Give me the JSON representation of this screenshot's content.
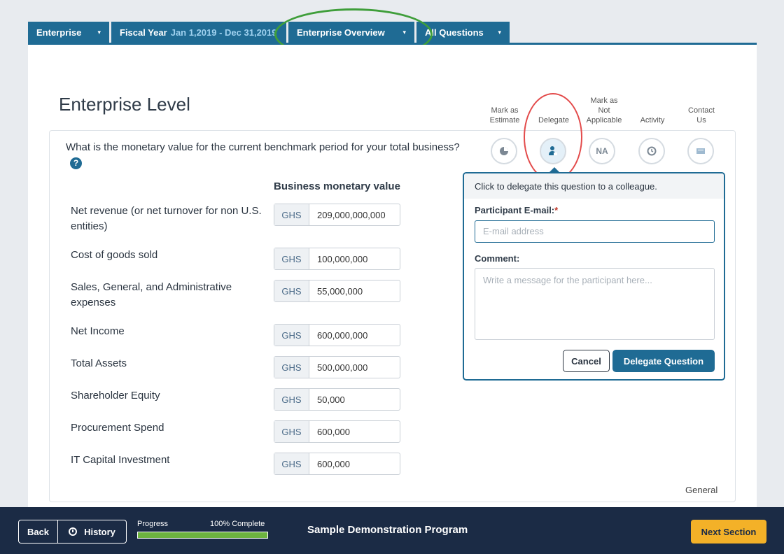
{
  "tabs": {
    "enterprise": "Enterprise",
    "fiscal_year_label": "Fiscal Year",
    "fiscal_year_dates": "Jan 1,2019 - Dec 31,2019",
    "overview": "Enterprise Overview",
    "all_questions": "All Questions",
    "caret": "▾"
  },
  "page_title": "Enterprise Level",
  "question": {
    "text": "What is the monetary value for the current benchmark period for your total business?",
    "help": "?",
    "column_header": "Business monetary value"
  },
  "rows": [
    {
      "label": "Net revenue (or net turnover for non U.S. entities)",
      "currency": "GHS",
      "value": "209,000,000,000"
    },
    {
      "label": "Cost of goods sold",
      "currency": "GHS",
      "value": "100,000,000"
    },
    {
      "label": "Sales, General, and Administrative expenses",
      "currency": "GHS",
      "value": "55,000,000"
    },
    {
      "label": "Net Income",
      "currency": "GHS",
      "value": "600,000,000"
    },
    {
      "label": "Total Assets",
      "currency": "GHS",
      "value": "500,000,000"
    },
    {
      "label": "Shareholder Equity",
      "currency": "GHS",
      "value": "50,000"
    },
    {
      "label": "Procurement Spend",
      "currency": "GHS",
      "value": "600,000"
    },
    {
      "label": "IT Capital Investment",
      "currency": "GHS",
      "value": "600,000"
    }
  ],
  "actions": {
    "estimate_line1": "Mark as",
    "estimate_line2": "Estimate",
    "delegate": "Delegate",
    "na_line1": "Mark as",
    "na_line2": "Not",
    "na_line3": "Applicable",
    "na_icon_text": "NA",
    "activity": "Activity",
    "contact_line1": "Contact",
    "contact_line2": "Us"
  },
  "delegate_popover": {
    "header": "Click to delegate this question to a colleague.",
    "email_label": "Participant E-mail:",
    "required_mark": "*",
    "email_placeholder": "E-mail address",
    "comment_label": "Comment:",
    "comment_placeholder": "Write a message for the participant here...",
    "cancel": "Cancel",
    "submit": "Delegate Question"
  },
  "section_footer": "General",
  "footer": {
    "back": "Back",
    "history": "History",
    "progress_label": "Progress",
    "progress_text": "100% Complete",
    "progress_fraction": 1.0,
    "program": "Sample Demonstration Program",
    "next": "Next Section"
  },
  "colors": {
    "primary": "#1f6b94",
    "accent": "#f3b128",
    "progress": "#6db33f",
    "annotation_green": "#3f9e3a",
    "annotation_red": "#e34b4b"
  }
}
